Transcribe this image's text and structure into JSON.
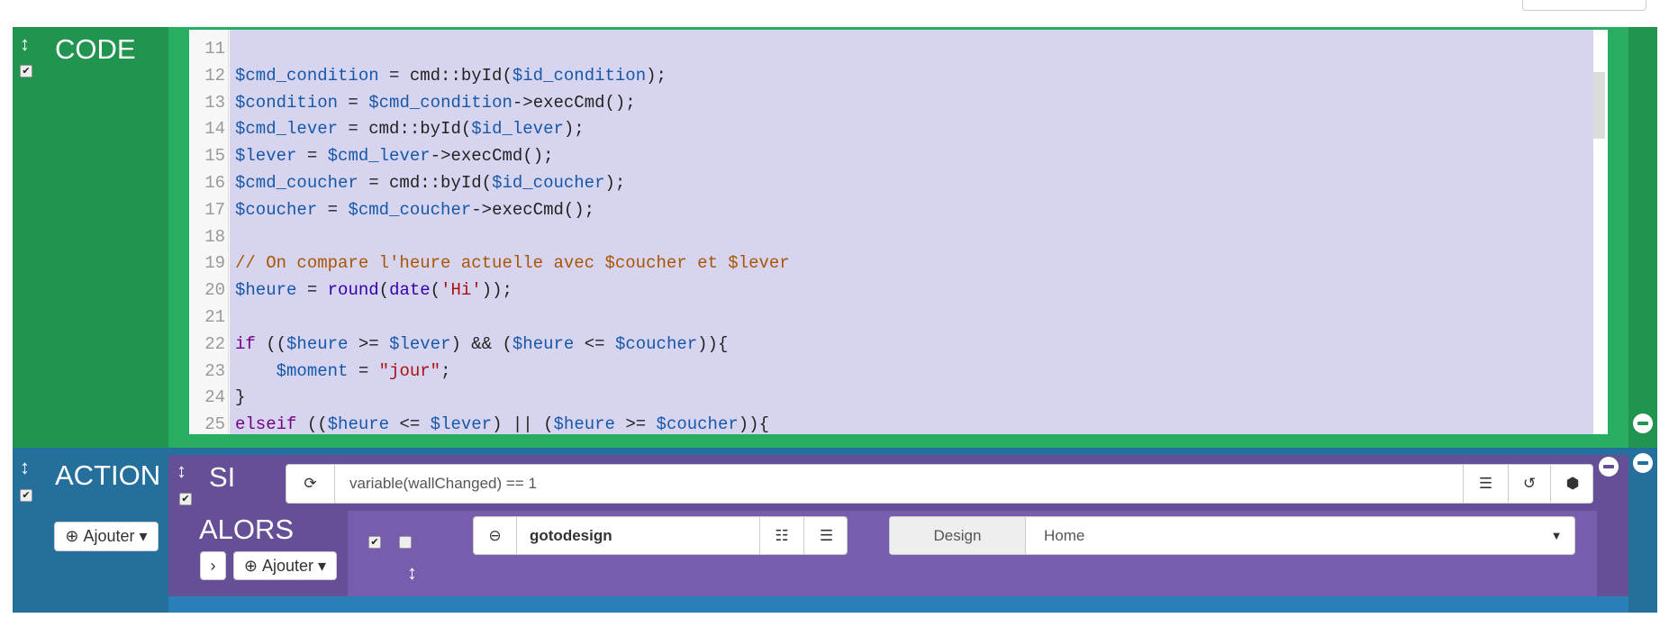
{
  "code_block": {
    "title": "CODE",
    "enabled": true,
    "lines": [
      {
        "n": "11",
        "tokens": []
      },
      {
        "n": "12",
        "tokens": [
          [
            "v",
            "$cmd_condition"
          ],
          [
            "",
            "  = cmd::byId("
          ],
          [
            "v",
            "$id_condition"
          ],
          [
            "",
            ");"
          ]
        ]
      },
      {
        "n": "13",
        "tokens": [
          [
            "v",
            "$condition"
          ],
          [
            "",
            " = "
          ],
          [
            "v",
            "$cmd_condition"
          ],
          [
            "",
            "->execCmd();"
          ]
        ]
      },
      {
        "n": "14",
        "tokens": [
          [
            "v",
            "$cmd_lever"
          ],
          [
            "",
            " = cmd::byId("
          ],
          [
            "v",
            "$id_lever"
          ],
          [
            "",
            ");"
          ]
        ]
      },
      {
        "n": "15",
        "tokens": [
          [
            "v",
            "$lever"
          ],
          [
            "",
            " = "
          ],
          [
            "v",
            "$cmd_lever"
          ],
          [
            "",
            "->execCmd();"
          ]
        ]
      },
      {
        "n": "16",
        "tokens": [
          [
            "v",
            "$cmd_coucher"
          ],
          [
            "",
            " = cmd::byId("
          ],
          [
            "v",
            "$id_coucher"
          ],
          [
            "",
            ");"
          ]
        ]
      },
      {
        "n": "17",
        "tokens": [
          [
            "v",
            "$coucher"
          ],
          [
            "",
            " = "
          ],
          [
            "v",
            "$cmd_coucher"
          ],
          [
            "",
            "->execCmd();"
          ]
        ]
      },
      {
        "n": "18",
        "tokens": []
      },
      {
        "n": "19",
        "tokens": [
          [
            "c",
            "// On compare l'heure actuelle avec $coucher et $lever"
          ]
        ]
      },
      {
        "n": "20",
        "tokens": [
          [
            "v",
            "$heure"
          ],
          [
            "",
            " = "
          ],
          [
            "b",
            "round"
          ],
          [
            "",
            "("
          ],
          [
            "b",
            "date"
          ],
          [
            "",
            "("
          ],
          [
            "s",
            "'Hi'"
          ],
          [
            "",
            "));"
          ]
        ]
      },
      {
        "n": "21",
        "tokens": []
      },
      {
        "n": "22",
        "tokens": [
          [
            "k",
            "if"
          ],
          [
            "",
            " (("
          ],
          [
            "v",
            "$heure"
          ],
          [
            "",
            " >= "
          ],
          [
            "v",
            "$lever"
          ],
          [
            "",
            ") && ("
          ],
          [
            "v",
            "$heure"
          ],
          [
            "",
            " <= "
          ],
          [
            "v",
            "$coucher"
          ],
          [
            "",
            ")){"
          ]
        ]
      },
      {
        "n": "23",
        "tokens": [
          [
            "",
            "    "
          ],
          [
            "v",
            "$moment"
          ],
          [
            "",
            " = "
          ],
          [
            "s",
            "\"jour\""
          ],
          [
            "",
            ";"
          ]
        ]
      },
      {
        "n": "24",
        "tokens": [
          [
            "",
            "}"
          ]
        ]
      },
      {
        "n": "25",
        "tokens": [
          [
            "k",
            "elseif"
          ],
          [
            "",
            " (("
          ],
          [
            "v",
            "$heure"
          ],
          [
            "",
            " <= "
          ],
          [
            "v",
            "$lever"
          ],
          [
            "",
            ") || ("
          ],
          [
            "v",
            "$heure"
          ],
          [
            "",
            " >= "
          ],
          [
            "v",
            "$coucher"
          ],
          [
            "",
            ")){"
          ]
        ]
      }
    ]
  },
  "action_block": {
    "title": "ACTION",
    "enabled": true,
    "add_label": "Ajouter",
    "si": {
      "label": "SI",
      "enabled": true,
      "condition": "variable(wallChanged) == 1"
    },
    "alors": {
      "label": "ALORS",
      "add_label": "Ajouter",
      "action": {
        "enabled": true,
        "background": false,
        "command": "gotodesign",
        "param_label": "Design",
        "param_value": "Home"
      }
    }
  },
  "colors": {
    "code_dark": "#21944f",
    "code_light": "#27ae60",
    "action_blue": "#256f9c",
    "si_purple": "#654f96",
    "alors_purple": "#765dae",
    "editor_bg": "#d7d4f0"
  }
}
